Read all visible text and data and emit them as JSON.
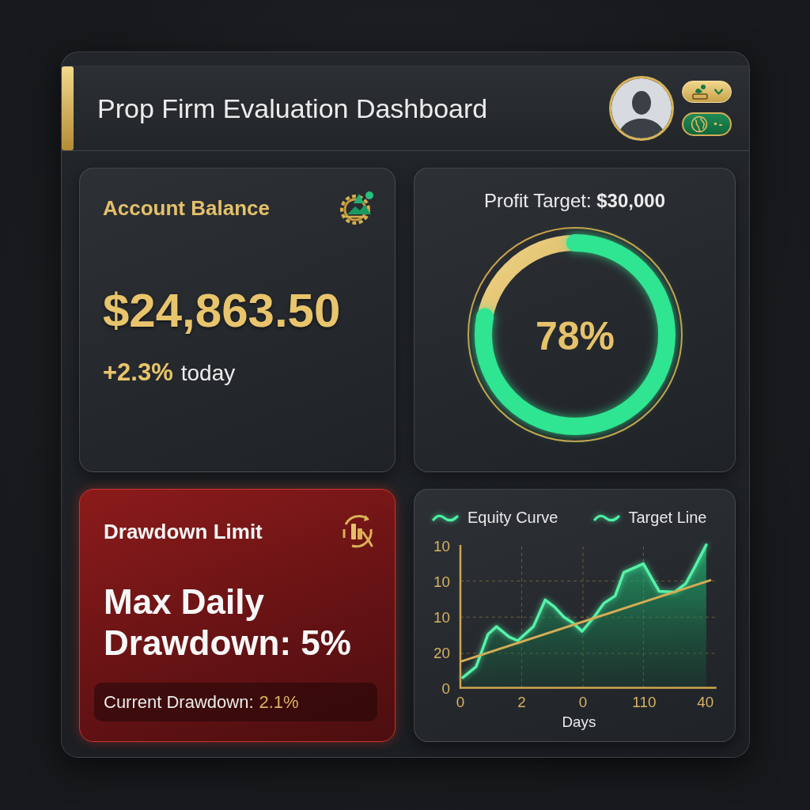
{
  "header": {
    "title": "Prop Firm Evaluation Dashboard",
    "buttons": [
      {
        "kind": "user-menu"
      },
      {
        "kind": "globe"
      }
    ]
  },
  "balance_card": {
    "title": "Account Balance",
    "amount": "$24,863.50",
    "change": "+2.3%",
    "change_label": "today"
  },
  "profit_card": {
    "title": "Profit Target: **$30,000**",
    "level": 0.78,
    "percent": "78%"
  },
  "drawdown_card": {
    "title": "Drawdown Limit",
    "headline": "Max Daily Drawdown: 5%",
    "current_label": "Current Drawdown:",
    "current_value": "2.1%"
  },
  "equity_card": {
    "legend": [
      {
        "label": "Equity Curve"
      },
      {
        "label": "Target Line"
      }
    ],
    "y_tick_labels": [
      "10",
      "10",
      "10",
      "20",
      "0"
    ],
    "x_tick_labels": [
      "0",
      "2",
      "0",
      "110",
      "40"
    ],
    "xlabel": "Days"
  }
}
